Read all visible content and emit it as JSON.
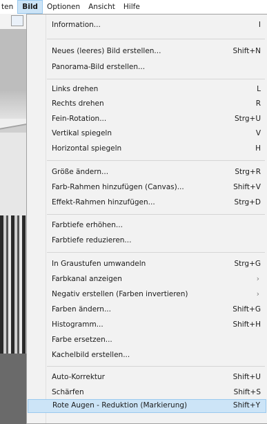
{
  "menubar": {
    "items": [
      {
        "label": "ten"
      },
      {
        "label": "Bild"
      },
      {
        "label": "Optionen"
      },
      {
        "label": "Ansicht"
      },
      {
        "label": "Hilfe"
      }
    ]
  },
  "menu": {
    "items": [
      {
        "label": "Information...",
        "shortcut": "I"
      },
      {
        "label": "Neues (leeres) Bild erstellen...",
        "shortcut": "Shift+N"
      },
      {
        "label": "Panorama-Bild erstellen...",
        "shortcut": ""
      },
      {
        "label": "Links drehen",
        "shortcut": "L"
      },
      {
        "label": "Rechts drehen",
        "shortcut": "R"
      },
      {
        "label": "Fein-Rotation...",
        "shortcut": "Strg+U"
      },
      {
        "label": "Vertikal spiegeln",
        "shortcut": "V"
      },
      {
        "label": "Horizontal spiegeln",
        "shortcut": "H"
      },
      {
        "label": "Größe ändern...",
        "shortcut": "Strg+R"
      },
      {
        "label": "Farb-Rahmen hinzufügen (Canvas)...",
        "shortcut": "Shift+V"
      },
      {
        "label": "Effekt-Rahmen hinzufügen...",
        "shortcut": "Strg+D"
      },
      {
        "label": "Farbtiefe erhöhen...",
        "shortcut": ""
      },
      {
        "label": "Farbtiefe reduzieren...",
        "shortcut": ""
      },
      {
        "label": "In Graustufen umwandeln",
        "shortcut": "Strg+G"
      },
      {
        "label": "Farbkanal anzeigen",
        "shortcut": ""
      },
      {
        "label": "Negativ erstellen (Farben invertieren)",
        "shortcut": ""
      },
      {
        "label": "Farben ändern...",
        "shortcut": "Shift+G"
      },
      {
        "label": "Histogramm...",
        "shortcut": "Shift+H"
      },
      {
        "label": "Farbe ersetzen...",
        "shortcut": ""
      },
      {
        "label": "Kachelbild erstellen...",
        "shortcut": ""
      },
      {
        "label": "Auto-Korrektur",
        "shortcut": "Shift+U"
      },
      {
        "label": "Schärfen",
        "shortcut": "Shift+S"
      },
      {
        "label": "Rote Augen - Reduktion (Markierung)",
        "shortcut": "Shift+Y"
      }
    ]
  }
}
